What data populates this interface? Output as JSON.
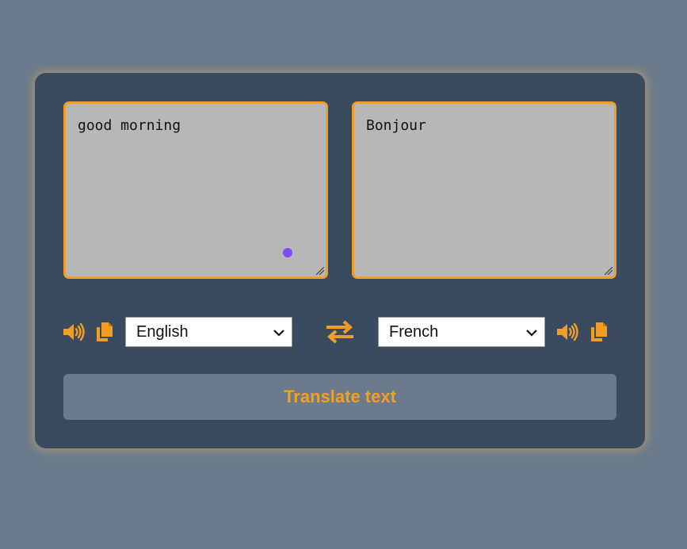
{
  "source": {
    "text": "good morning",
    "language": "English"
  },
  "target": {
    "text": "Bonjour",
    "language": "French"
  },
  "translate_button": {
    "label": "Translate text"
  },
  "colors": {
    "page_background": "#6c7b8b",
    "card_background": "#3a4b60",
    "accent": "#f29e26",
    "textarea_background": "#b7b7b7",
    "cursor_dot": "#7c4dff"
  },
  "icons": {
    "speak": "volume-icon",
    "copy": "copy-icon",
    "swap": "exchange-icon",
    "dropdown": "chevron-down-icon"
  }
}
